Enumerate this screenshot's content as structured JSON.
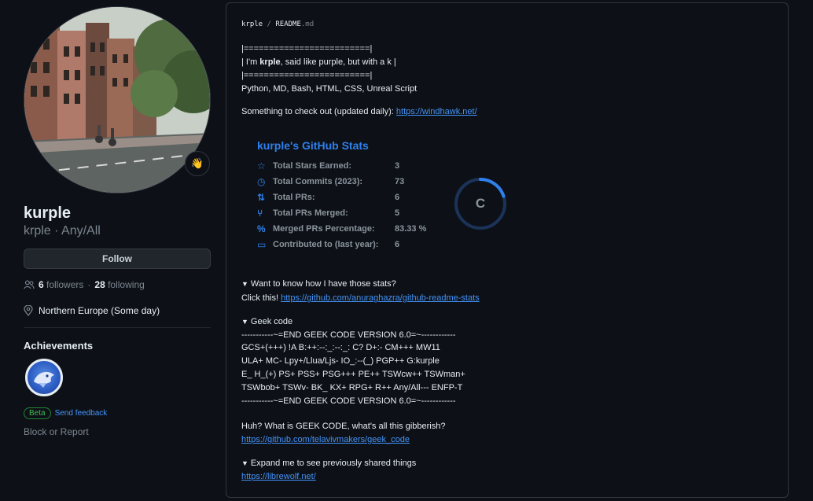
{
  "profile": {
    "name": "kurple",
    "subtitle": "krple · Any/All",
    "status_emoji": "👋",
    "follow_label": "Follow",
    "followers_count": "6",
    "followers_label": "followers",
    "separator": "·",
    "following_count": "28",
    "following_label": "following",
    "location": "Northern Europe (Some day)",
    "achievements_title": "Achievements",
    "beta_label": "Beta",
    "feedback_label": "Send feedback",
    "block_label": "Block or Report"
  },
  "readme": {
    "breadcrumb_user": "krple",
    "breadcrumb_sep": "/",
    "breadcrumb_file": "README",
    "breadcrumb_ext": ".md",
    "banner_line1": "|=========================|",
    "banner_line2_pre": "| I'm ",
    "banner_line2_bold": "krple",
    "banner_line2_post": ", said like purple, but with a k |",
    "banner_line3": "|=========================|",
    "languages": "Python, MD, Bash, HTML, CSS, Unreal Script",
    "check_out_text": "Something to check out (updated daily): ",
    "check_out_link": "https://windhawk.net/",
    "stats_details_summary": "Want to know how I have those stats?",
    "stats_click_text": "Click this! ",
    "stats_click_link": "https://github.com/anuraghazra/github-readme-stats",
    "geek_summary": "Geek code",
    "geek_lines": [
      "-----------~=END GEEK CODE VERSION 6.0=~------------",
      "GCS+(+++) !A B:++:--:_:--:_: C? D+:- CM+++ MW11",
      "ULA+ MC- Lpy+/Llua/Ljs- IO_:--(_) PGP++ G:kurple",
      "E_ H_(+) PS+ PSS+ PSG+++ PE++ TSWcw++ TSWman+",
      "TSWbob+ TSWv- BK_ KX+ RPG+ R++ Any/All--- ENFP-T",
      "-----------~=END GEEK CODE VERSION 6.0=~------------"
    ],
    "geek_question": "Huh? What is GEEK CODE, what's all this gibberish?",
    "geek_link": "https://github.com/telavivmakers/geek_code",
    "expand_summary": "Expand me to see previously shared things",
    "expand_link": "https://librewolf.net/",
    "caret": "▼"
  },
  "stats_card": {
    "title": "kurple's GitHub Stats",
    "accent": "#2f80ed",
    "rows": [
      {
        "icon": "star-icon",
        "glyph": "☆",
        "label": "Total Stars Earned:",
        "value": "3"
      },
      {
        "icon": "history-icon",
        "glyph": "◷",
        "label": "Total Commits (2023):",
        "value": "73"
      },
      {
        "icon": "pull-request-icon",
        "glyph": "⇅",
        "label": "Total PRs:",
        "value": "6"
      },
      {
        "icon": "merge-icon",
        "glyph": "⑂",
        "label": "Total PRs Merged:",
        "value": "5"
      },
      {
        "icon": "percent-icon",
        "glyph": "%",
        "label": "Merged PRs Percentage:",
        "value": "83.33 %"
      },
      {
        "icon": "repo-icon",
        "glyph": "▭",
        "label": "Contributed to (last year):",
        "value": "6"
      }
    ],
    "rank_grade": "C",
    "rank_progress": 0.2
  }
}
